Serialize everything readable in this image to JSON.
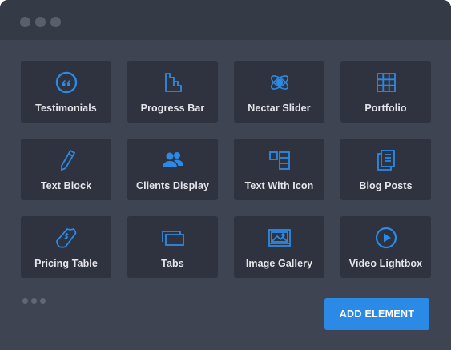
{
  "accent_color": "#2a8ae6",
  "window": {
    "controls": [
      "dot",
      "dot",
      "dot"
    ]
  },
  "elements": [
    {
      "label": "Testimonials",
      "icon": "quote-icon"
    },
    {
      "label": "Progress Bar",
      "icon": "progress-bar-icon"
    },
    {
      "label": "Nectar Slider",
      "icon": "atom-icon"
    },
    {
      "label": "Portfolio",
      "icon": "grid-icon"
    },
    {
      "label": "Text Block",
      "icon": "pencil-icon"
    },
    {
      "label": "Clients Display",
      "icon": "users-icon"
    },
    {
      "label": "Text With Icon",
      "icon": "text-with-icon-icon"
    },
    {
      "label": "Blog Posts",
      "icon": "documents-icon"
    },
    {
      "label": "Pricing Table",
      "icon": "money-icon"
    },
    {
      "label": "Tabs",
      "icon": "tabs-icon"
    },
    {
      "label": "Image Gallery",
      "icon": "image-icon"
    },
    {
      "label": "Video Lightbox",
      "icon": "play-icon"
    }
  ],
  "add_button": {
    "label": "ADD ELEMENT"
  }
}
